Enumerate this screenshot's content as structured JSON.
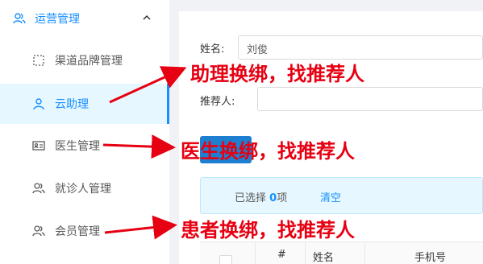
{
  "sidebar": {
    "group": {
      "label": "运营管理",
      "icon": "users-icon",
      "expanded_icon": "chevron-up-icon"
    },
    "items": [
      {
        "label": "渠道品牌管理",
        "icon": "dashed-square-icon"
      },
      {
        "label": "云助理",
        "icon": "user-icon",
        "active": true
      },
      {
        "label": "医生管理",
        "icon": "id-card-icon"
      },
      {
        "label": "就诊人管理",
        "icon": "users-icon"
      },
      {
        "label": "会员管理",
        "icon": "users-icon"
      }
    ]
  },
  "form": {
    "name_label": "姓名:",
    "name_value": "刘俊",
    "referrer_label": "推荐人:"
  },
  "alert": {
    "selected_prefix": "已选择 ",
    "selected_count": "0",
    "selected_suffix": "项",
    "clear_label": "清空"
  },
  "table": {
    "columns": [
      "#",
      "姓名",
      "手机号"
    ]
  },
  "annotations": {
    "assistant": "助理换绑，找推荐人",
    "doctor": "医生换绑，找推荐人",
    "patient": "患者换绑，找推荐人"
  },
  "colors": {
    "accent": "#1890ff",
    "annotation": "#e60012",
    "active_bg": "#e6f7ff"
  }
}
